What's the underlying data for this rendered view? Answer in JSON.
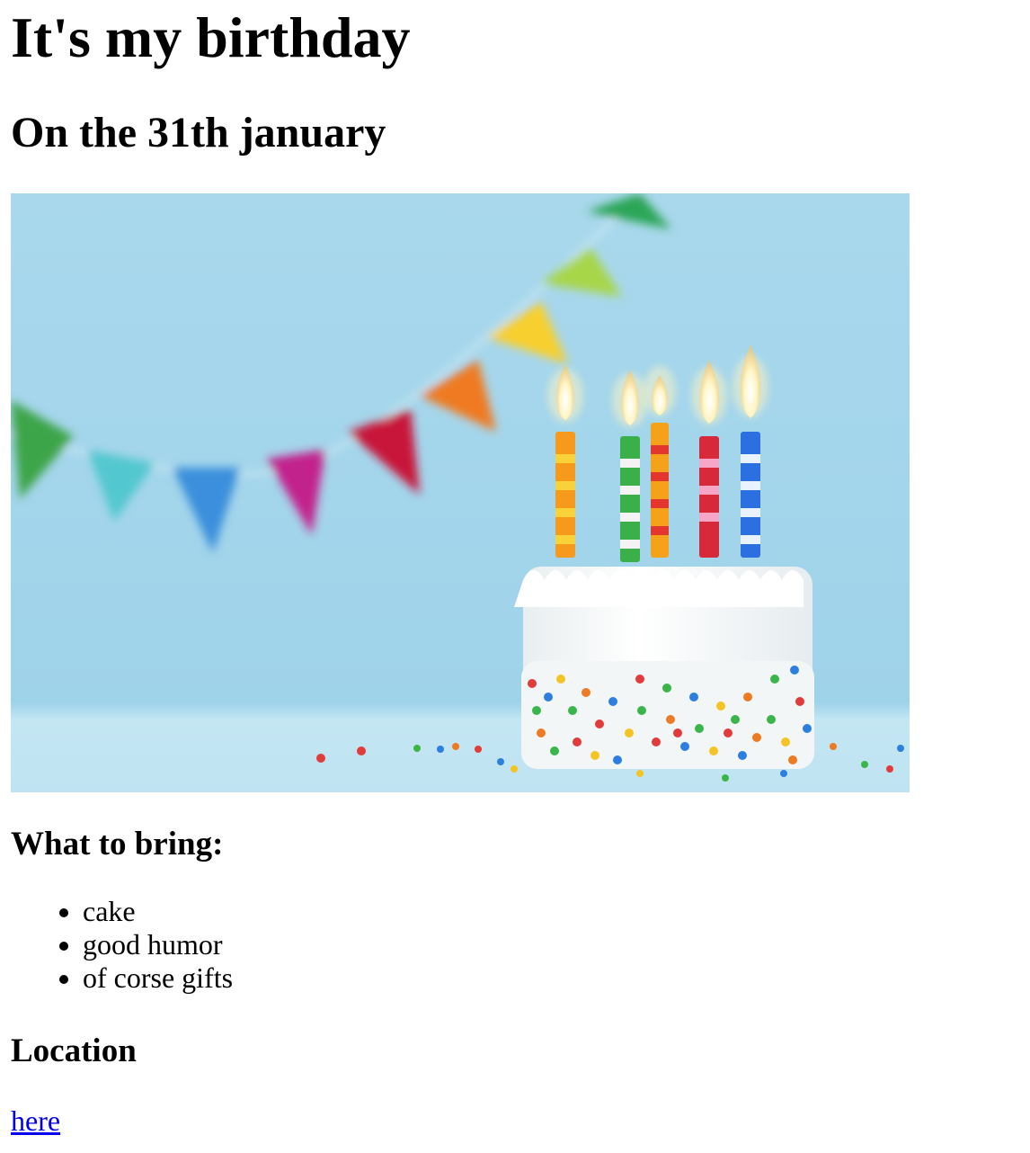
{
  "page": {
    "title": "It's my birthday",
    "subtitle": "On the 31th january"
  },
  "image": {
    "icon": "birthday-cake-image"
  },
  "bring": {
    "heading": "What to bring:",
    "items": [
      "cake",
      "good humor",
      "of corse gifts"
    ]
  },
  "location": {
    "heading": "Location",
    "link_text": "here"
  }
}
